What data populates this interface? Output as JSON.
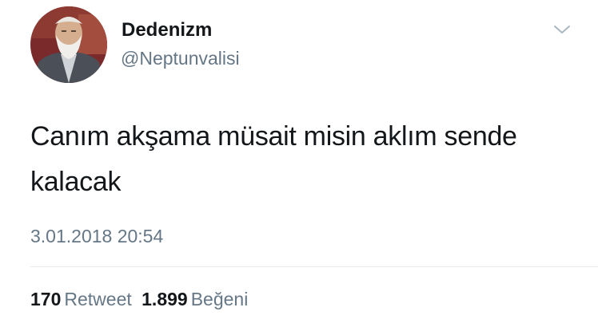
{
  "tweet": {
    "display_name": "Dedenizm",
    "handle": "@Neptunvalisi",
    "text": "Canım akşama müsait misin aklım sende kalacak",
    "timestamp": "3.01.2018 20:54",
    "retweets": {
      "count": "170",
      "label": "Retweet"
    },
    "likes": {
      "count": "1.899",
      "label": "Beğeni"
    }
  },
  "icons": {
    "menu": "chevron-down-icon",
    "avatar": "avatar"
  },
  "colors": {
    "primary_text": "#14171a",
    "secondary_text": "#657786",
    "divider": "#e6ecf0"
  }
}
